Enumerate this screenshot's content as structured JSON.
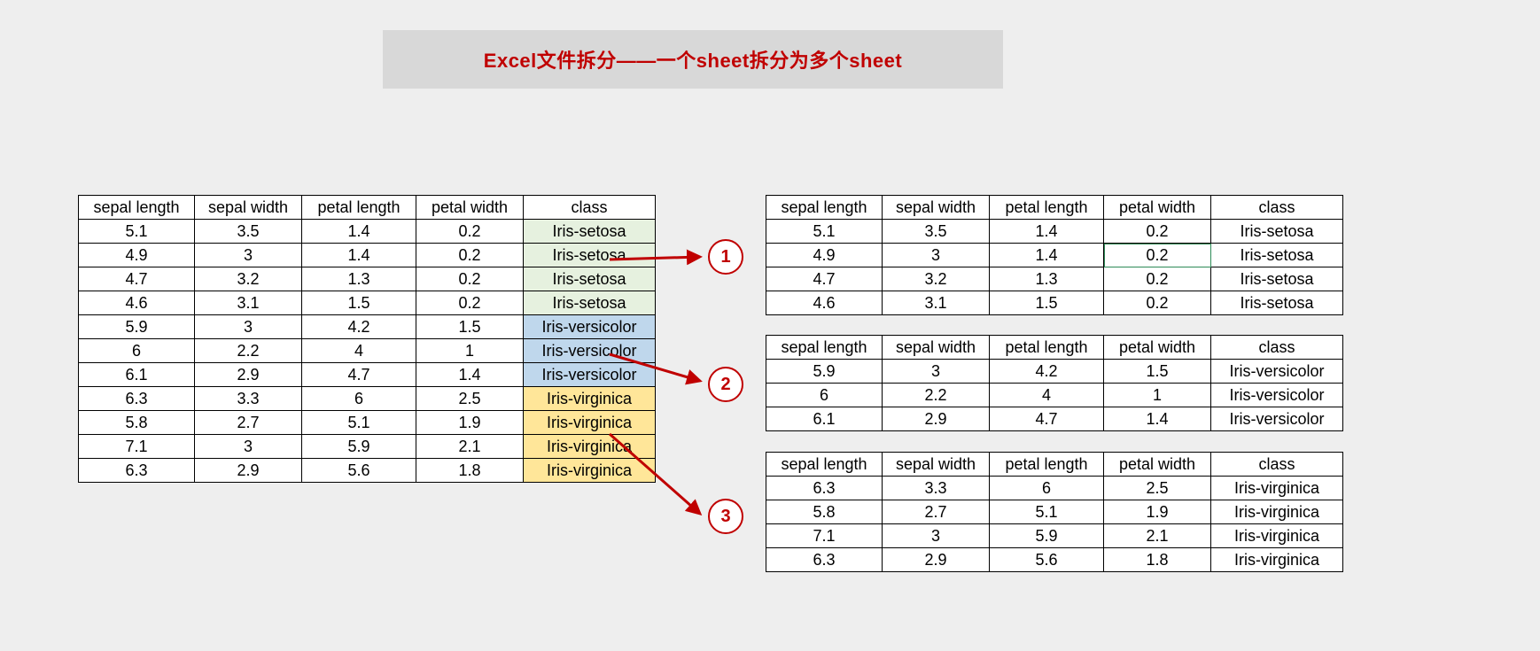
{
  "title": "Excel文件拆分——一个sheet拆分为多个sheet",
  "columns": [
    "sepal length",
    "sepal width",
    "petal length",
    "petal width",
    "class"
  ],
  "highlight_colors": {
    "Iris-setosa": "#e6f1df",
    "Iris-versicolor": "#bfd7ec",
    "Iris-virginica": "#ffe699"
  },
  "arrow_labels": [
    "1",
    "2",
    "3"
  ],
  "source_rows": [
    {
      "sl": "5.1",
      "sw": "3.5",
      "pl": "1.4",
      "pw": "0.2",
      "cl": "Iris-setosa"
    },
    {
      "sl": "4.9",
      "sw": "3",
      "pl": "1.4",
      "pw": "0.2",
      "cl": "Iris-setosa"
    },
    {
      "sl": "4.7",
      "sw": "3.2",
      "pl": "1.3",
      "pw": "0.2",
      "cl": "Iris-setosa"
    },
    {
      "sl": "4.6",
      "sw": "3.1",
      "pl": "1.5",
      "pw": "0.2",
      "cl": "Iris-setosa"
    },
    {
      "sl": "5.9",
      "sw": "3",
      "pl": "4.2",
      "pw": "1.5",
      "cl": "Iris-versicolor"
    },
    {
      "sl": "6",
      "sw": "2.2",
      "pl": "4",
      "pw": "1",
      "cl": "Iris-versicolor"
    },
    {
      "sl": "6.1",
      "sw": "2.9",
      "pl": "4.7",
      "pw": "1.4",
      "cl": "Iris-versicolor"
    },
    {
      "sl": "6.3",
      "sw": "3.3",
      "pl": "6",
      "pw": "2.5",
      "cl": "Iris-virginica"
    },
    {
      "sl": "5.8",
      "sw": "2.7",
      "pl": "5.1",
      "pw": "1.9",
      "cl": "Iris-virginica"
    },
    {
      "sl": "7.1",
      "sw": "3",
      "pl": "5.9",
      "pw": "2.1",
      "cl": "Iris-virginica"
    },
    {
      "sl": "6.3",
      "sw": "2.9",
      "pl": "5.6",
      "pw": "1.8",
      "cl": "Iris-virginica"
    }
  ],
  "output_tables": [
    {
      "rows": [
        {
          "sl": "5.1",
          "sw": "3.5",
          "pl": "1.4",
          "pw": "0.2",
          "cl": "Iris-setosa"
        },
        {
          "sl": "4.9",
          "sw": "3",
          "pl": "1.4",
          "pw": "0.2",
          "cl": "Iris-setosa"
        },
        {
          "sl": "4.7",
          "sw": "3.2",
          "pl": "1.3",
          "pw": "0.2",
          "cl": "Iris-setosa"
        },
        {
          "sl": "4.6",
          "sw": "3.1",
          "pl": "1.5",
          "pw": "0.2",
          "cl": "Iris-setosa"
        }
      ],
      "selected_cell": {
        "row": 1,
        "col": "pw"
      }
    },
    {
      "rows": [
        {
          "sl": "5.9",
          "sw": "3",
          "pl": "4.2",
          "pw": "1.5",
          "cl": "Iris-versicolor"
        },
        {
          "sl": "6",
          "sw": "2.2",
          "pl": "4",
          "pw": "1",
          "cl": "Iris-versicolor"
        },
        {
          "sl": "6.1",
          "sw": "2.9",
          "pl": "4.7",
          "pw": "1.4",
          "cl": "Iris-versicolor"
        }
      ]
    },
    {
      "rows": [
        {
          "sl": "6.3",
          "sw": "3.3",
          "pl": "6",
          "pw": "2.5",
          "cl": "Iris-virginica"
        },
        {
          "sl": "5.8",
          "sw": "2.7",
          "pl": "5.1",
          "pw": "1.9",
          "cl": "Iris-virginica"
        },
        {
          "sl": "7.1",
          "sw": "3",
          "pl": "5.9",
          "pw": "2.1",
          "cl": "Iris-virginica"
        },
        {
          "sl": "6.3",
          "sw": "2.9",
          "pl": "5.6",
          "pw": "1.8",
          "cl": "Iris-virginica"
        }
      ]
    }
  ]
}
